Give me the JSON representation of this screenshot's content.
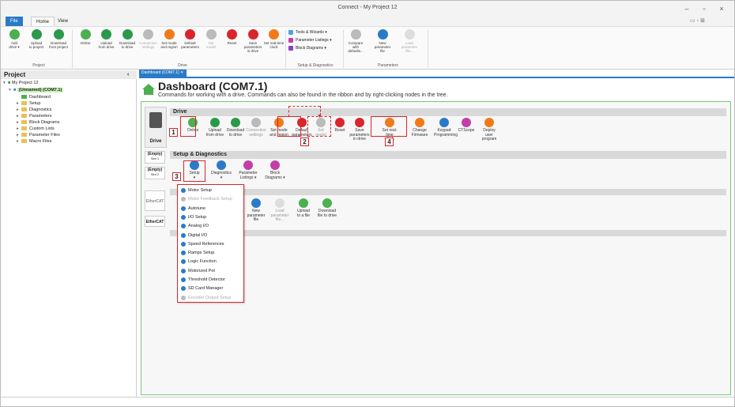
{
  "window": {
    "title": "Connect - My Project 12",
    "min": "–",
    "max": "▫",
    "close": "×"
  },
  "tabs": {
    "file": "File",
    "home": "Home",
    "view": "View"
  },
  "ribbon": {
    "project_buttons": [
      {
        "l1": "Add",
        "l2": "drive ▾"
      },
      {
        "l1": "Upload",
        "l2": "to project"
      },
      {
        "l1": "Download",
        "l2": "from project"
      }
    ],
    "project_group": "Project",
    "drive_buttons": [
      {
        "l1": "Online",
        "l2": ""
      },
      {
        "l1": "Upload",
        "l2": "from drive"
      },
      {
        "l1": "Download",
        "l2": "to drive"
      },
      {
        "l1": "Connection",
        "l2": "settings"
      },
      {
        "l1": "Set mode",
        "l2": "and region"
      },
      {
        "l1": "Default",
        "l2": "parameters"
      },
      {
        "l1": "Set",
        "l2": "model"
      },
      {
        "l1": "Reset",
        "l2": ""
      },
      {
        "l1": "Save parameters",
        "l2": "in drive"
      },
      {
        "l1": "Set real-time",
        "l2": "clock"
      }
    ],
    "drive_group": "Drive",
    "setup_items": [
      "Tools & Wizards",
      "Parameter Listings",
      "Block Diagrams"
    ],
    "setup_group": "Setup & Diagnostics",
    "param_buttons": [
      {
        "l1": "Compare with",
        "l2": "defaults..."
      },
      {
        "l1": "New",
        "l2": "parameter file"
      },
      {
        "l1": "Load",
        "l2": "parameter file..."
      }
    ],
    "param_group": "Parameters"
  },
  "project": {
    "header": "Project",
    "collapse": "‹",
    "root": "My Project 12",
    "drive": "(Unnamed) (COM7.1)",
    "nodes": [
      "Dashboard",
      "Setup",
      "Diagnostics",
      "Parameters",
      "Block Diagrams",
      "Custom Lists",
      "Parameter Files",
      "Macro Files"
    ]
  },
  "doc_tab": "Dashboard (COM7.1) ✕",
  "dashboard": {
    "title": "Dashboard (COM7.1)",
    "subtitle": "Commands for working with a drive. Commands can also be found in the ribbon and by right-clicking nodes in the tree."
  },
  "side": {
    "drive": "Drive",
    "slot1": "(Empty)",
    "slot1b": "Slot 1",
    "slot2": "(Empty)",
    "slot2b": "Slot 2",
    "ethercat_logo": "EtherCAT",
    "ethercat": "EtherCAT"
  },
  "drive_section": {
    "title": "Drive",
    "buttons": [
      {
        "l1": "Online",
        "l2": ""
      },
      {
        "l1": "Upload",
        "l2": "from drive"
      },
      {
        "l1": "Download",
        "l2": "to drive"
      },
      {
        "l1": "Connection",
        "l2": "settings"
      },
      {
        "l1": "Set mode",
        "l2": "and region"
      },
      {
        "l1": "Default",
        "l2": "parameters"
      },
      {
        "l1": "Set",
        "l2": "model"
      },
      {
        "l1": "Reset",
        "l2": ""
      },
      {
        "l1": "Save parameters",
        "l2": "in drive"
      },
      {
        "l1": "Set real-time",
        "l2": "clock"
      },
      {
        "l1": "Change",
        "l2": "Firmware"
      },
      {
        "l1": "Keypad",
        "l2": "Programming"
      },
      {
        "l1": "CTScope",
        "l2": ""
      },
      {
        "l1": "Deploy user",
        "l2": "program"
      }
    ]
  },
  "setup_section": {
    "title": "Setup & Diagnostics",
    "buttons": [
      {
        "l1": "Setup",
        "l2": "▾"
      },
      {
        "l1": "Diagnostics",
        "l2": "▾"
      },
      {
        "l1": "Parameter",
        "l2": "Listings ▾"
      },
      {
        "l1": "Block",
        "l2": "Diagrams ▾"
      }
    ]
  },
  "param_section": {
    "buttons": [
      {
        "l1": "New",
        "l2": "parameter file"
      },
      {
        "l1": "Load",
        "l2": "parameter file..."
      },
      {
        "l1": "Upload",
        "l2": "to a file"
      },
      {
        "l1": "Download",
        "l2": "file to drive"
      }
    ]
  },
  "menu": [
    "Motor Setup",
    "Motor Feedback Setup",
    "Autotune",
    "I/O Setup",
    "Analog I/O",
    "Digital I/O",
    "Speed References",
    "Ramps Setup",
    "Logic Function",
    "Motorized Pot",
    "Threshold Detector",
    "SD Card Manager",
    "Encoder Output Setup"
  ],
  "menu_disabled": [
    1,
    12
  ],
  "callouts": [
    "1",
    "2",
    "3",
    "4"
  ]
}
